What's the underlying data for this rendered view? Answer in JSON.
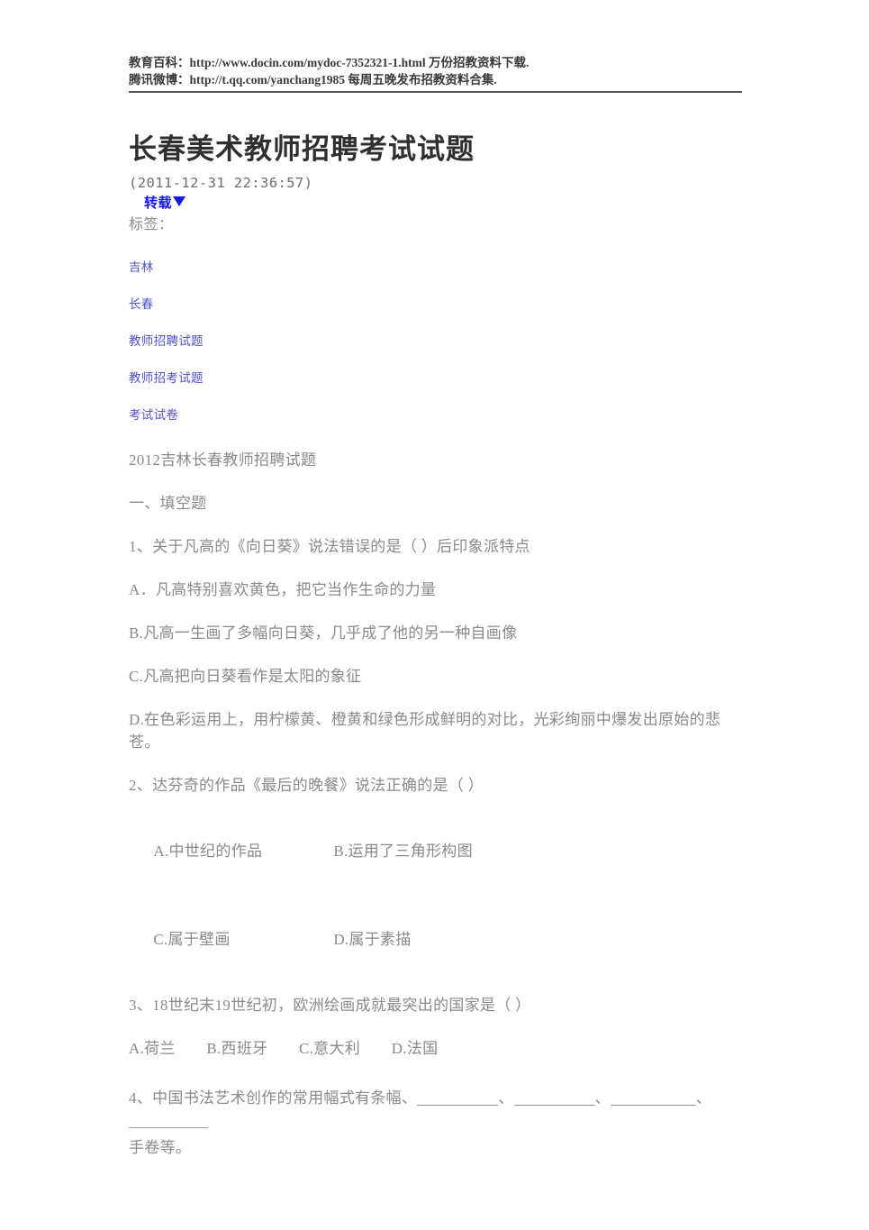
{
  "promo": {
    "line1": "教育百科：http://www.docin.com/mydoc-7352321-1.html 万份招教资料下载.",
    "line2": "腾讯微博：http://t.qq.com/yanchang1985 每周五晚发布招教资料合集."
  },
  "article": {
    "title": "长春美术教师招聘考试试题",
    "date": "(2011-12-31 22:36:57)",
    "repost_label": "转载",
    "repost_caret": "caret-down-icon",
    "tags_label": "标签：",
    "tags": [
      "吉林",
      "长春",
      "教师招聘试题",
      "教师招考试题",
      "考试试卷"
    ]
  },
  "content": {
    "exam_heading": "2012吉林长春教师招聘试题",
    "section_one": "一、填空题",
    "q1": {
      "stem": "1、关于凡高的《向日葵》说法错误的是（  ）后印象派特点",
      "a": "A．凡高特别喜欢黄色，把它当作生命的力量",
      "b": "B.凡高一生画了多幅向日葵，几乎成了他的另一种自画像",
      "c": "C.凡高把向日葵看作是太阳的象征",
      "d": "D.在色彩运用上，用柠檬黄、橙黄和绿色形成鲜明的对比，光彩绚丽中爆发出原始的悲苍。"
    },
    "q2": {
      "stem": "2、达芬奇的作品《最后的晚餐》说法正确的是（    ）",
      "a": "A.中世纪的作品",
      "b": "B.运用了三角形构图",
      "c": "C.属于壁画",
      "d": "D.属于素描"
    },
    "q3": {
      "stem": "3、18世纪末19世纪初，欧洲绘画成就最突出的国家是（  ）",
      "options": "A.荷兰　　B.西班牙　　C.意大利　　D.法国"
    },
    "q4": {
      "prefix": "4、中国书法艺术创作的常用幅式有条幅、",
      "sep": "、",
      "line2_prefix": "、",
      "suffix": "手卷等。"
    }
  },
  "colors": {
    "page_background": "#ffffff",
    "body_text": "#8a8a8a",
    "title_text": "#2f2f2f",
    "promo_text": "#3a3a3a",
    "tag_link": "#5252cf",
    "repost_link": "#1515ee",
    "rule": "#555555",
    "blank_rule": "#9a9a9a"
  }
}
